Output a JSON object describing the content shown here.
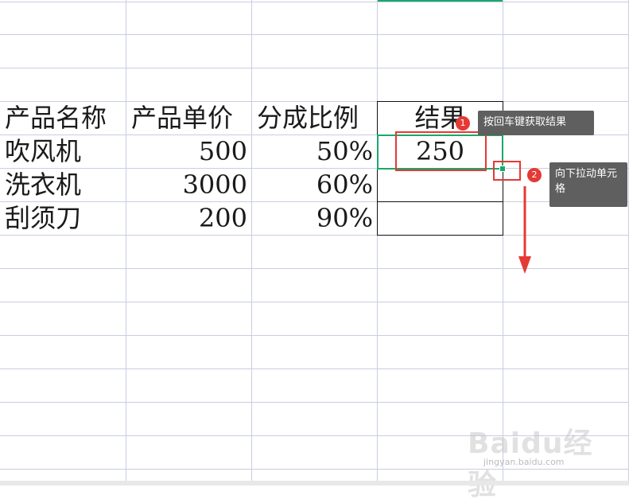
{
  "table": {
    "headers": [
      "产品名称",
      "产品单价",
      "分成比例",
      "结果"
    ],
    "rows": [
      {
        "name": "吹风机",
        "price": "500",
        "ratio": "50%",
        "result": "250"
      },
      {
        "name": "洗衣机",
        "price": "3000",
        "ratio": "60%",
        "result": ""
      },
      {
        "name": "刮须刀",
        "price": "200",
        "ratio": "90%",
        "result": ""
      }
    ]
  },
  "annotations": [
    {
      "number": "1",
      "text": "按回车键获取结果"
    },
    {
      "number": "2",
      "text": "向下拉动单元格"
    }
  ],
  "watermark": {
    "main": "Baidu经验",
    "sub": "jingyan.baidu.com"
  },
  "colors": {
    "selection": "#1ba86b",
    "highlight": "#e53935",
    "gridline": "#c9cde0",
    "tooltip_bg": "#5f5f5f"
  },
  "icons": {
    "annotation_arrow": "down-arrow-icon",
    "fill_handle": "fill-handle-icon"
  }
}
